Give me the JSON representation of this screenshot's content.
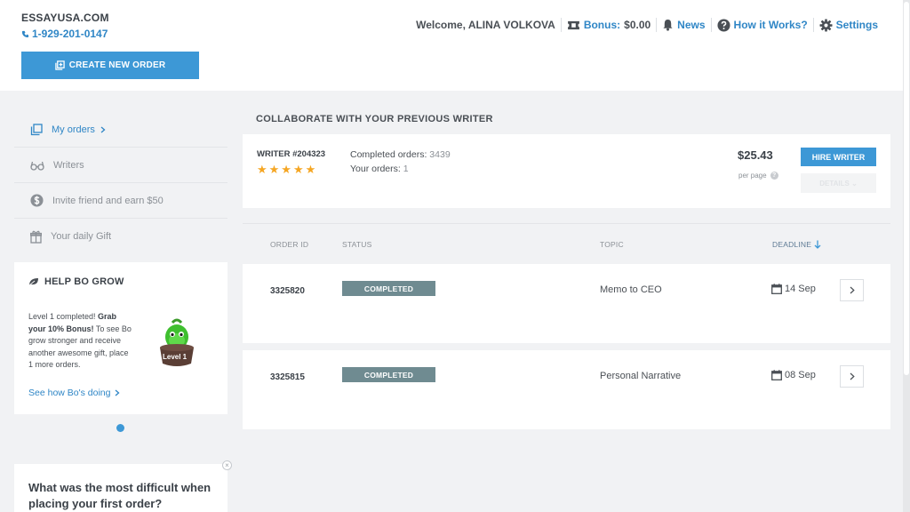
{
  "brand": {
    "name": "ESSAYUSA.COM",
    "phone": "1-929-201-0147"
  },
  "create_order": {
    "label": "CREATE NEW ORDER"
  },
  "topnav": {
    "welcome": "Welcome, ALINA VOLKOVA",
    "bonus_label": "Bonus:",
    "bonus_value": "$0.00",
    "news": "News",
    "how_it_works": "How it Works?",
    "settings": "Settings"
  },
  "sidebar": {
    "items": [
      {
        "label": "My orders",
        "icon": "copy-icon"
      },
      {
        "label": "Writers",
        "icon": "glasses-icon"
      },
      {
        "label": "Invite friend and earn $50",
        "icon": "dollar-icon"
      },
      {
        "label": "Your daily Gift",
        "icon": "gift-icon"
      }
    ]
  },
  "grow": {
    "title": "HELP BO GROW",
    "text_1": "Level 1 completed! ",
    "text_bold": "Grab your 10% Bonus!",
    "text_2": " To see Bo grow stronger and receive another awesome gift, place 1 more orders.",
    "link": "See how Bo's doing",
    "level": "Level 1"
  },
  "question": {
    "text": "What was the most difficult when placing your first order?"
  },
  "collab": {
    "title": "COLLABORATE WITH YOUR PREVIOUS WRITER",
    "writer_id": "WRITER #204323",
    "stars": "★★★★★",
    "completed_label": "Completed orders:",
    "completed_value": "3439",
    "your_orders_label": "Your orders:",
    "your_orders_value": "1",
    "price": "$25.43",
    "per_page": "per page",
    "hire": "HIRE WRITER",
    "details": "DETAILS"
  },
  "table": {
    "columns": {
      "order_id": "ORDER ID",
      "status": "STATUS",
      "topic": "TOPIC",
      "deadline": "DEADLINE"
    },
    "rows": [
      {
        "id": "3325820",
        "status": "COMPLETED",
        "topic": "Memo to CEO",
        "deadline": "14 Sep"
      },
      {
        "id": "3325815",
        "status": "COMPLETED",
        "topic": "Personal Narrative",
        "deadline": "08 Sep"
      }
    ]
  },
  "colors": {
    "accent": "#3d98d6",
    "link": "#2f86c6",
    "status": "#6f8b91",
    "star": "#f5a623"
  }
}
